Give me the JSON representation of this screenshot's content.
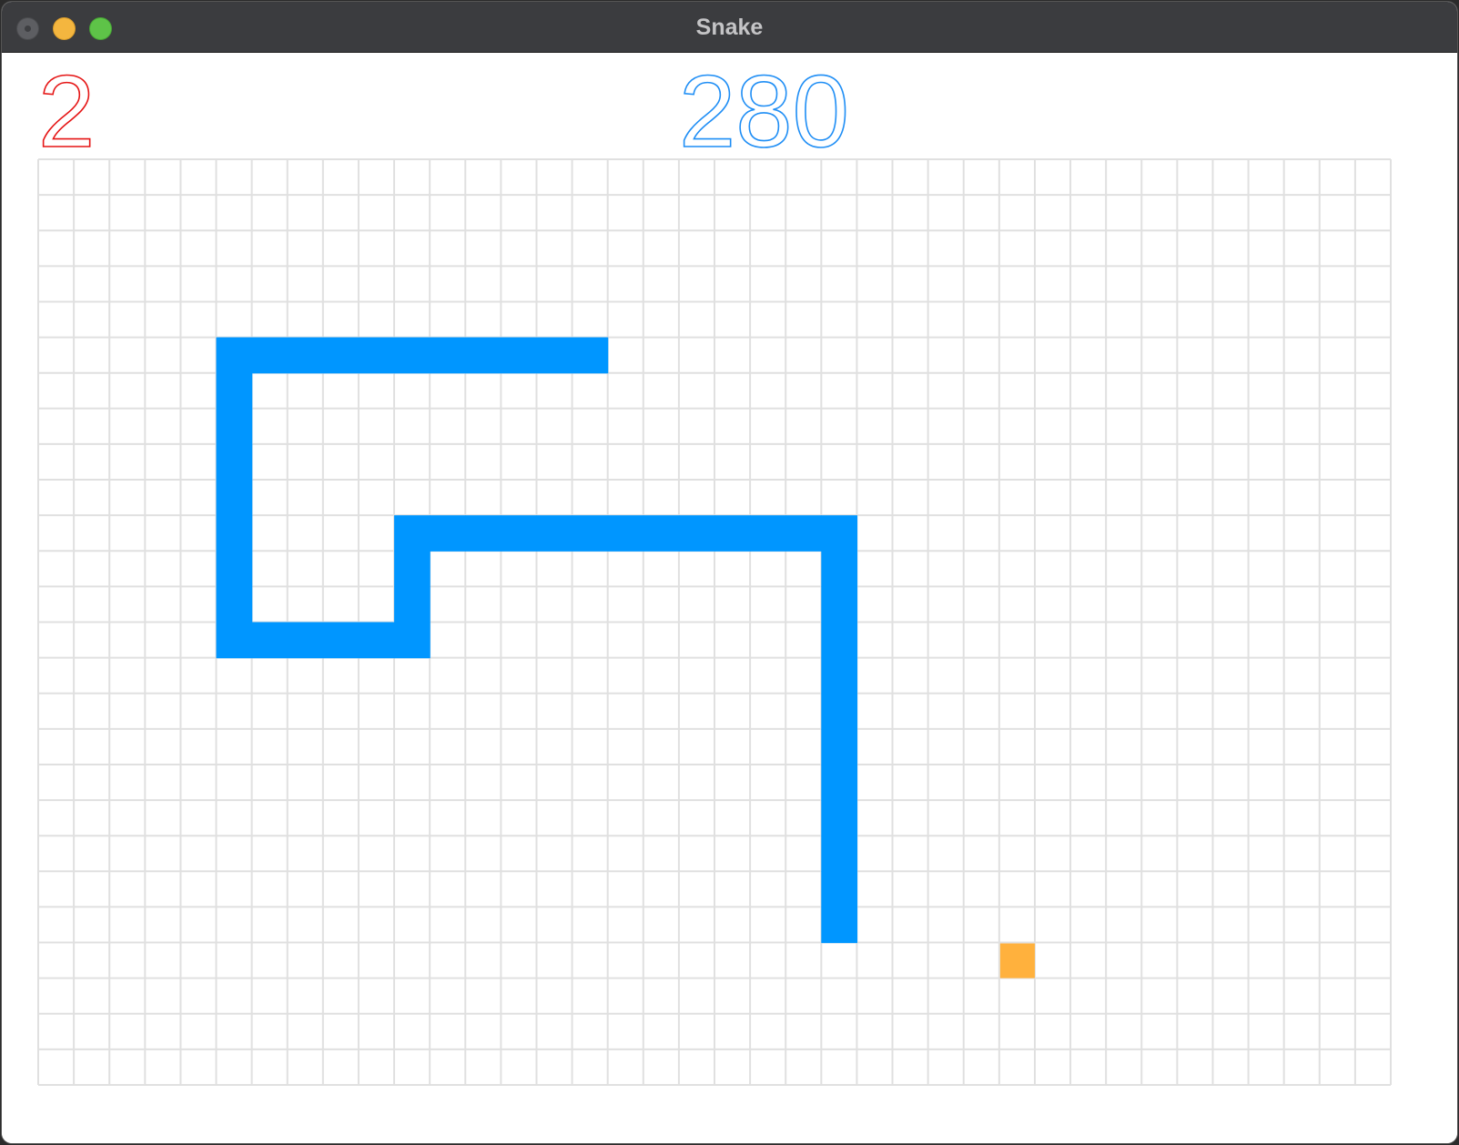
{
  "window": {
    "title": "Snake"
  },
  "hud": {
    "lives": "2",
    "score": "280"
  },
  "colors": {
    "lives": "#e51515",
    "score": "#1f8ef5",
    "snake": "#0096ff",
    "food": "#ffb13d",
    "grid": "#e0e0e0"
  },
  "game": {
    "grid_columns": 38,
    "grid_rows": 26,
    "snake_cells": [
      [
        15,
        5
      ],
      [
        14,
        5
      ],
      [
        13,
        5
      ],
      [
        12,
        5
      ],
      [
        11,
        5
      ],
      [
        10,
        5
      ],
      [
        9,
        5
      ],
      [
        8,
        5
      ],
      [
        7,
        5
      ],
      [
        6,
        5
      ],
      [
        5,
        5
      ],
      [
        5,
        6
      ],
      [
        5,
        7
      ],
      [
        5,
        8
      ],
      [
        5,
        9
      ],
      [
        5,
        10
      ],
      [
        5,
        11
      ],
      [
        5,
        12
      ],
      [
        5,
        13
      ],
      [
        6,
        13
      ],
      [
        7,
        13
      ],
      [
        8,
        13
      ],
      [
        9,
        13
      ],
      [
        10,
        13
      ],
      [
        10,
        12
      ],
      [
        10,
        11
      ],
      [
        10,
        10
      ],
      [
        11,
        10
      ],
      [
        12,
        10
      ],
      [
        13,
        10
      ],
      [
        14,
        10
      ],
      [
        15,
        10
      ],
      [
        16,
        10
      ],
      [
        17,
        10
      ],
      [
        18,
        10
      ],
      [
        19,
        10
      ],
      [
        20,
        10
      ],
      [
        21,
        10
      ],
      [
        22,
        10
      ],
      [
        22,
        11
      ],
      [
        22,
        12
      ],
      [
        22,
        13
      ],
      [
        22,
        14
      ],
      [
        22,
        15
      ],
      [
        22,
        16
      ],
      [
        22,
        17
      ],
      [
        22,
        18
      ],
      [
        22,
        19
      ],
      [
        22,
        20
      ],
      [
        22,
        21
      ]
    ],
    "food_cell": [
      27,
      22
    ]
  }
}
